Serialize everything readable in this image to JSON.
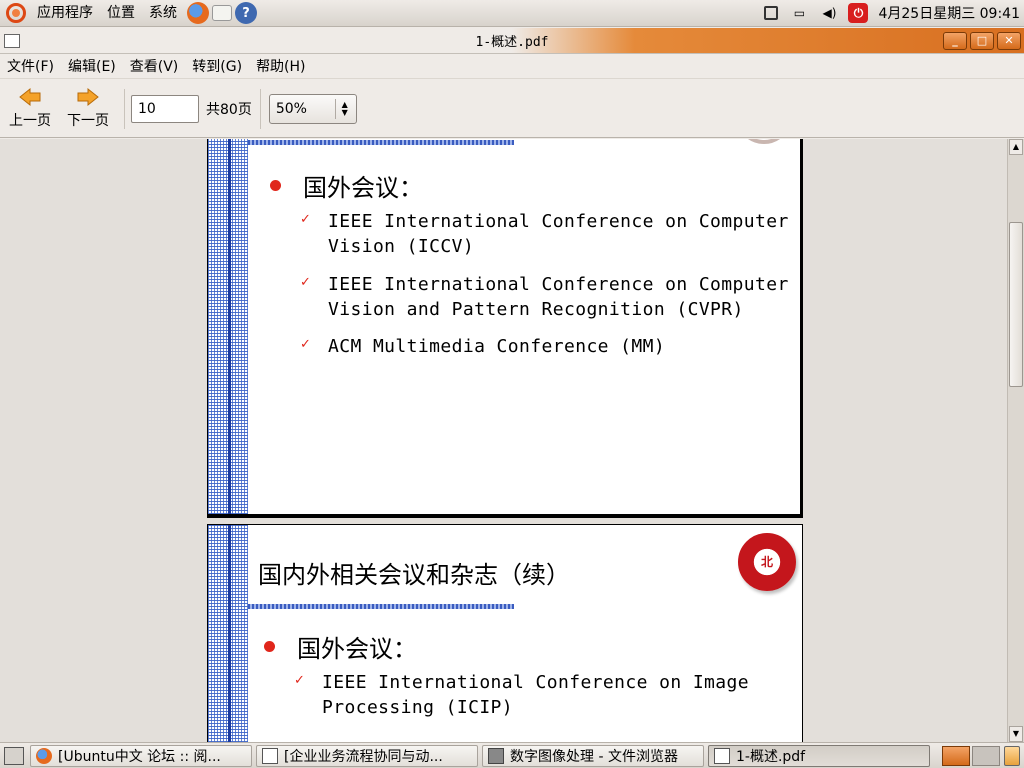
{
  "top_panel": {
    "menus": [
      "应用程序",
      "位置",
      "系统"
    ],
    "launchers": [
      "firefox-icon",
      "mail-icon",
      "help-icon"
    ],
    "clock": "4月25日星期三 09:41"
  },
  "window": {
    "title": "1-概述.pdf",
    "buttons": [
      "minimize",
      "maximize",
      "close"
    ]
  },
  "menubar": {
    "items": [
      "文件(F)",
      "编辑(E)",
      "查看(V)",
      "转到(G)",
      "帮助(H)"
    ]
  },
  "toolbar": {
    "prev_label": "上一页",
    "next_label": "下一页",
    "page_value": "10",
    "page_total": "共80页",
    "zoom_value": "50%"
  },
  "document": {
    "page1": {
      "bullet_head": "国外会议：",
      "items": [
        "IEEE International Conference on Computer\nVision (ICCV)",
        "IEEE International Conference on Computer\nVision and Pattern Recognition (CVPR)",
        "ACM Multimedia Conference (MM)"
      ]
    },
    "page2": {
      "title": "国内外相关会议和杂志（续）",
      "bullet_head": "国外会议：",
      "items": [
        "IEEE International Conference on Image\nProcessing (ICIP)"
      ]
    }
  },
  "taskbar": {
    "tasks": [
      {
        "label": "[Ubuntu中文 论坛 :: 阅...",
        "icon": "firefox-icon"
      },
      {
        "label": "[企业业务流程协同与动...",
        "icon": "document-icon"
      },
      {
        "label": "数字图像处理 - 文件浏览器",
        "icon": "folder-icon"
      },
      {
        "label": "1-概述.pdf",
        "icon": "pdf-icon"
      }
    ]
  },
  "colors": {
    "accent_orange": "#d86f20",
    "bullet_red": "#e0261b",
    "slide_blue": "#3a5cc0"
  }
}
